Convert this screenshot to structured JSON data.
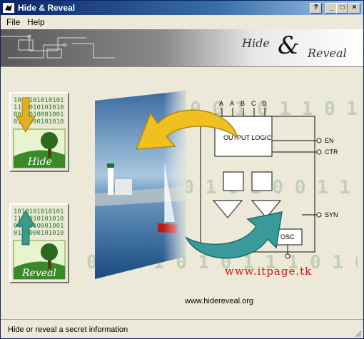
{
  "window": {
    "title": "Hide & Reveal",
    "controls": {
      "help": "?",
      "minimize": "_",
      "maximize": "□",
      "close": "×"
    }
  },
  "menu": {
    "items": [
      "File",
      "Help"
    ]
  },
  "banner": {
    "logo_hide": "Hide",
    "logo_amp": "&",
    "logo_reveal": "Reveal"
  },
  "buttons": {
    "hide": {
      "label": "Hide",
      "binary_lines": [
        "1010101010101",
        "1101010101010",
        "0001010001001",
        "0101000101010"
      ]
    },
    "reveal": {
      "label": "Reveal",
      "binary_lines": [
        "1010101010101",
        "1101010101010",
        "0001010001001",
        "0101000101010"
      ]
    }
  },
  "hero": {
    "pins_top": [
      "A",
      "B",
      "C",
      "D"
    ],
    "pins_top_extra": "A",
    "output_logic": "OUTPUT LOGIC",
    "osc": "OSC",
    "pin_en": "EN",
    "pin_ctr": "CTR",
    "pin_syn": "SYN",
    "binary_rows": [
      "0 1 0 1 0 0 1 0 1 1 0 1 0 1 1 0 1 0",
      "1 0 1 1 0 1 0 1 0 0 1 1 0 1 0 0 1 1",
      "0 0 1 1 0 1 0 1 1 1 0 1 0 1 0 1 1 0"
    ]
  },
  "site_url": "www.hidereveal.org",
  "watermark": "www.itpage.tk",
  "status": {
    "text": "Hide or reveal a secret information"
  },
  "colors": {
    "title_start": "#0a246a",
    "title_end": "#a6caf0",
    "arrow_yellow": "#f0c020",
    "arrow_teal": "#3a9a9a",
    "watermark": "#e01010"
  }
}
